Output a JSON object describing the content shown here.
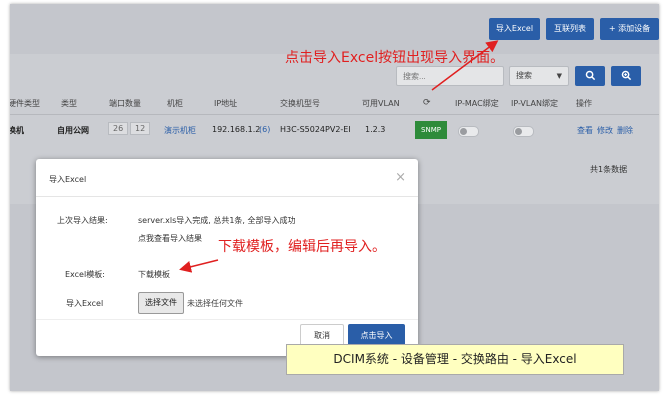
{
  "toolbar": {
    "import_excel": "导入Excel",
    "interconnect_list": "互联列表",
    "add_device": "+ 添加设备"
  },
  "search": {
    "placeholder": "搜索...",
    "select_value": "搜索"
  },
  "table": {
    "headers": [
      "硬件类型",
      "类型",
      "端口数量",
      "机柜",
      "IP地址",
      "交换机型号",
      "可用VLAN",
      "IP-MAC绑定",
      "IP-VLAN绑定",
      "操作"
    ],
    "row": {
      "hw_type": "换机",
      "type": "自用公网",
      "port_a": "26",
      "port_b": "12",
      "cabinet": "演示机柜",
      "ip": "192.168.1.2",
      "ip_count": "(6)",
      "model": "H3C-S5024PV2-EI",
      "vlan": "1.2.3",
      "snmp": "SNMP",
      "actions": [
        "查看",
        "修改",
        "删除"
      ]
    },
    "total": "共1条数据"
  },
  "modal": {
    "title": "导入Excel",
    "close": "×",
    "last_result_label": "上次导入结果:",
    "last_result_text": "server.xls导入完成, 总共1条, 全部导入成功",
    "view_result_link": "点我查看导入结果",
    "template_label": "Excel模板:",
    "template_link": "下载模板",
    "import_label": "导入Excel",
    "choose_file": "选择文件",
    "no_file": "未选择任何文件",
    "cancel": "取消",
    "confirm": "点击导入"
  },
  "annotations": {
    "top": "点击导入Excel按钮出现导入界面。",
    "middle": "下载模板，编辑后再导入。",
    "caption": "DCIM系统 - 设备管理 - 交换路由 - 导入Excel"
  },
  "colors": {
    "primary": "#2a5ea8",
    "annotation": "#e02020",
    "snmp_green": "#2e8b3a",
    "caption_bg": "#ffffc0"
  }
}
